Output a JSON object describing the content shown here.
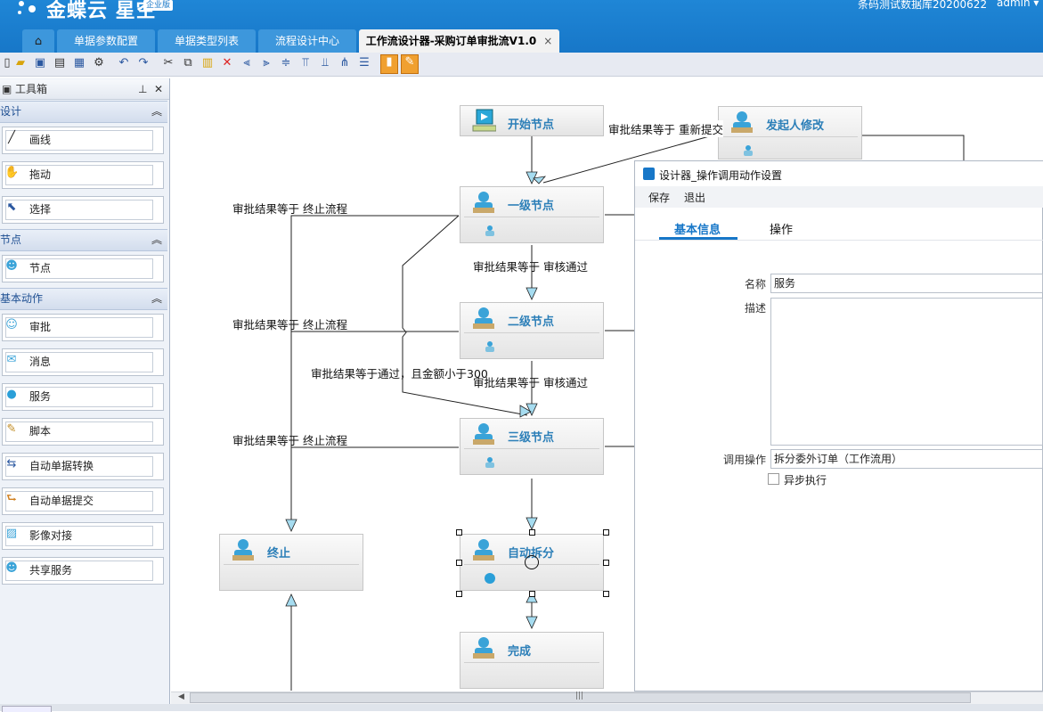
{
  "header": {
    "logo_text": "金蝶云 星空",
    "logo_badge": "企业版",
    "database": "条码测试数据库20200622",
    "user": "admin ▾",
    "home_icon": "home-icon",
    "tabs": [
      {
        "label": "单据参数配置"
      },
      {
        "label": "单据类型列表"
      },
      {
        "label": "流程设计中心"
      },
      {
        "label": "工作流设计器-采购订单审批流V1.0",
        "close": "×"
      }
    ]
  },
  "toolbox": {
    "title": "工具箱",
    "pin": "ₜ",
    "close": "✕",
    "sections": [
      {
        "label": "设计",
        "items": [
          {
            "label": "画线",
            "icon": "line-icon"
          },
          {
            "label": "拖动",
            "icon": "hand-icon"
          },
          {
            "label": "选择",
            "icon": "cursor-icon"
          }
        ]
      },
      {
        "label": "节点",
        "items": [
          {
            "label": "节点",
            "icon": "person-icon"
          }
        ]
      },
      {
        "label": "基本动作",
        "items": [
          {
            "label": "审批",
            "icon": "approve-icon"
          },
          {
            "label": "消息",
            "icon": "mail-icon"
          },
          {
            "label": "服务",
            "icon": "globe-icon"
          },
          {
            "label": "脚本",
            "icon": "script-icon"
          },
          {
            "label": "自动单据转换",
            "icon": "convert-icon"
          },
          {
            "label": "自动单据提交",
            "icon": "submit-icon"
          },
          {
            "label": "影像对接",
            "icon": "image-icon"
          },
          {
            "label": "共享服务",
            "icon": "share-icon"
          }
        ]
      }
    ]
  },
  "canvas": {
    "nodes": {
      "start": "开始节点",
      "initiator_edit": "发起人修改",
      "level1": "一级节点",
      "level2": "二级节点",
      "level3": "三级节点",
      "terminate": "终止",
      "auto_split": "自动拆分",
      "complete": "完成"
    },
    "edges": {
      "resubmit": "审批结果等于 重新提交",
      "terminate1": "审批结果等于 终止流程",
      "terminate2": "审批结果等于 终止流程",
      "terminate3": "审批结果等于 终止流程",
      "pass1": "审批结果等于 审核通过",
      "pass2": "审批结果等于 审核通过",
      "pass_amount": "审批结果等于通过，且金额小于300"
    }
  },
  "dialog": {
    "title": "设计器_操作调用动作设置",
    "menu": {
      "save": "保存",
      "exit": "退出"
    },
    "tabs": {
      "basic": "基本信息",
      "operation": "操作"
    },
    "fields": {
      "name_label": "名称",
      "name_value": "服务",
      "desc_label": "描述",
      "desc_value": "",
      "invoke_label": "调用操作",
      "invoke_value": "拆分委外订单（工作流用）",
      "async_label": "异步执行",
      "async_checked": false
    }
  }
}
